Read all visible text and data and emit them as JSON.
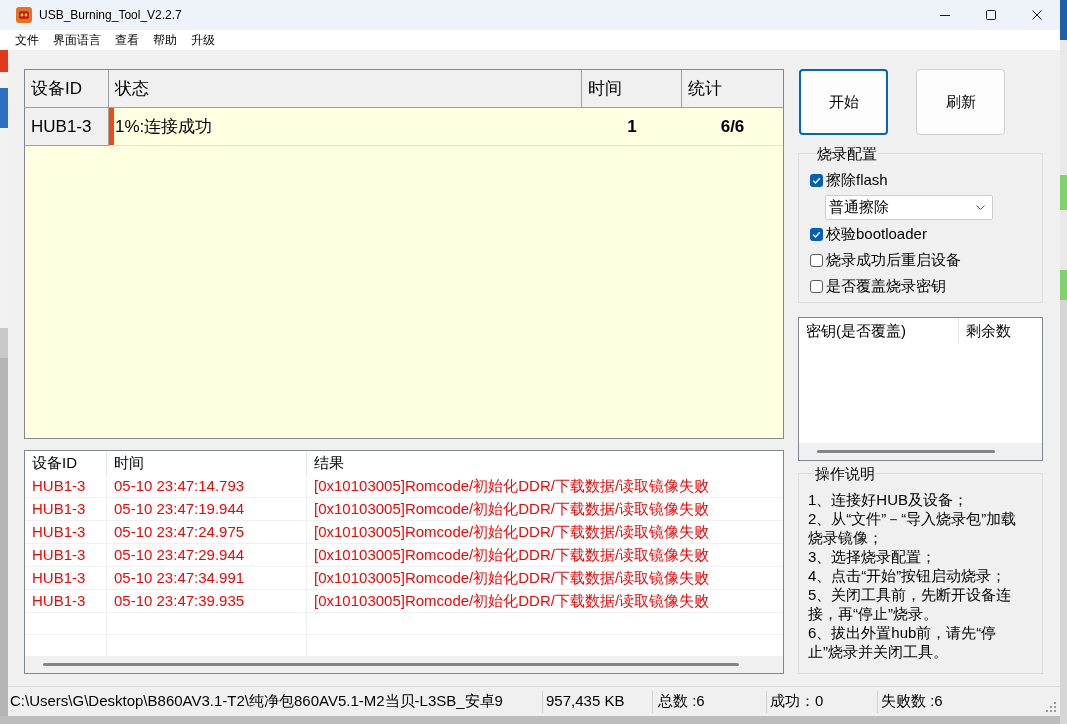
{
  "window": {
    "title": "USB_Burning_Tool_V2.2.7"
  },
  "menu": [
    "文件",
    "界面语言",
    "查看",
    "帮助",
    "升级"
  ],
  "device_table": {
    "columns": [
      "设备ID",
      "状态",
      "时间",
      "统计"
    ],
    "rows": [
      {
        "device_id": "HUB1-3",
        "status": "1%:连接成功",
        "level": 0.01,
        "time": "1",
        "count": "6/6"
      }
    ]
  },
  "buttons": [
    {
      "label": "开始",
      "focused": true
    },
    {
      "label": "刷新",
      "focused": false
    }
  ],
  "burn_config": {
    "title": "烧录配置",
    "options": [
      {
        "kind": "checkbox",
        "label": "擦除flash",
        "checked": true
      },
      {
        "kind": "dropdown",
        "value": "普通擦除"
      },
      {
        "kind": "checkbox",
        "label": "校验bootloader",
        "checked": true
      },
      {
        "kind": "checkbox",
        "label": "烧录成功后重启设备",
        "checked": false
      },
      {
        "kind": "checkbox",
        "label": "是否覆盖烧录密钥",
        "checked": false
      }
    ]
  },
  "key_list": {
    "columns": [
      "密钥(是否覆盖)",
      "剩余数"
    ]
  },
  "instructions": {
    "title": "操作说明",
    "lines": [
      "1、连接好HUB及设备；",
      "2、从“文件”－“导入烧录包”加载烧录镜像；",
      "3、选择烧录配置；",
      "4、点击“开始”按钮启动烧录；",
      "5、关闭工具前，先断开设备连接，再“停止”烧录。",
      "6、拔出外置hub前，请先“停止”烧录并关闭工具。"
    ]
  },
  "log_table": {
    "columns": [
      "设备ID",
      "时间",
      "结果"
    ],
    "rows": [
      {
        "device_id": "HUB1-3",
        "time": "05-10 23:47:14.793",
        "result": "[0x10103005]Romcode/初始化DDR/下载数据/读取镜像失败",
        "failed": true
      },
      {
        "device_id": "HUB1-3",
        "time": "05-10 23:47:19.944",
        "result": "[0x10103005]Romcode/初始化DDR/下载数据/读取镜像失败",
        "failed": true
      },
      {
        "device_id": "HUB1-3",
        "time": "05-10 23:47:24.975",
        "result": "[0x10103005]Romcode/初始化DDR/下载数据/读取镜像失败",
        "failed": true
      },
      {
        "device_id": "HUB1-3",
        "time": "05-10 23:47:29.944",
        "result": "[0x10103005]Romcode/初始化DDR/下载数据/读取镜像失败",
        "failed": true
      },
      {
        "device_id": "HUB1-3",
        "time": "05-10 23:47:34.991",
        "result": "[0x10103005]Romcode/初始化DDR/下载数据/读取镜像失败",
        "failed": true
      },
      {
        "device_id": "HUB1-3",
        "time": "05-10 23:47:39.935",
        "result": "[0x10103005]Romcode/初始化DDR/下载数据/读取镜像失败",
        "failed": true
      }
    ]
  },
  "status_bar": {
    "path": "C:\\Users\\G\\Desktop\\B860AV3.1-T2\\纯净包860AV5.1-M2当贝-L3SB_安卓9",
    "size": "957,435 KB",
    "total": "总数 :6",
    "success": "成功：0",
    "failed": "失败数 :6"
  }
}
